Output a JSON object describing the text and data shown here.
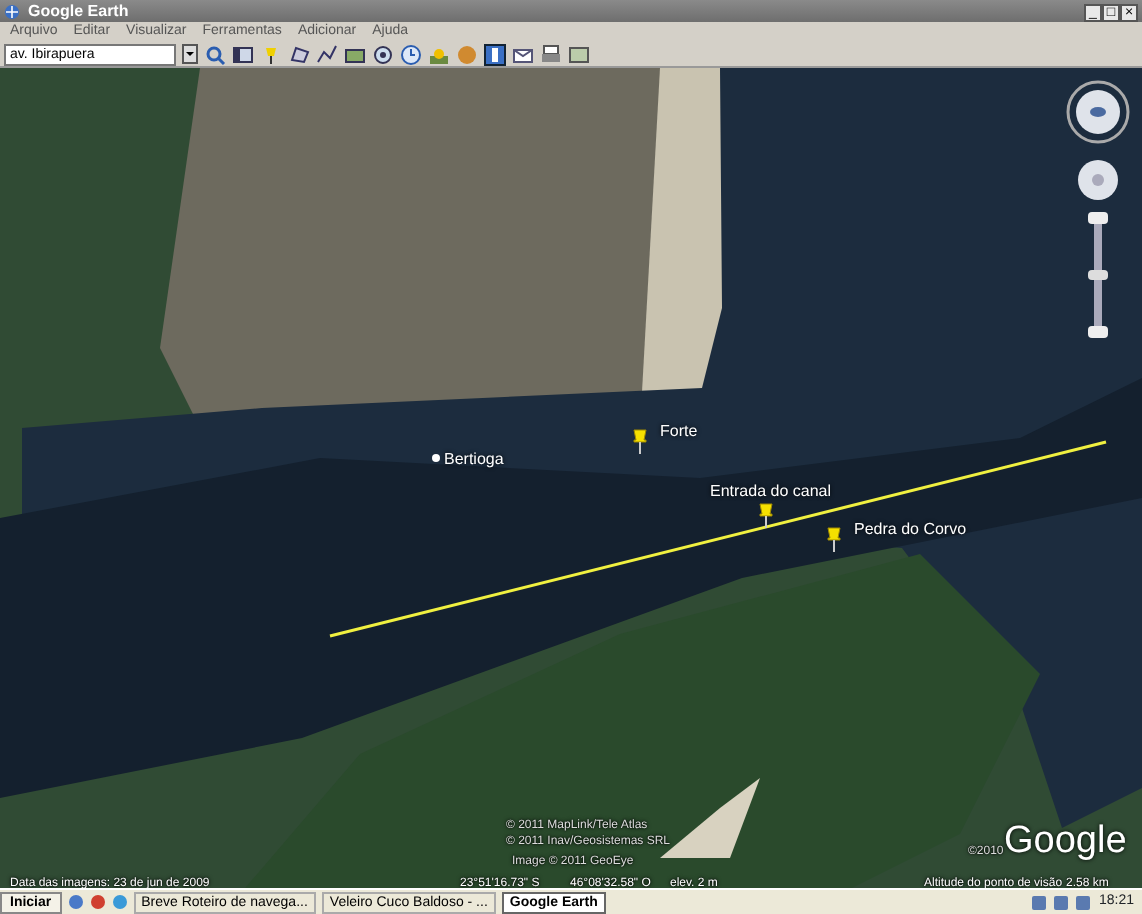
{
  "window": {
    "title": "Google Earth",
    "controls": [
      "_",
      "□",
      "×"
    ]
  },
  "menu": [
    "Arquivo",
    "Editar",
    "Visualizar",
    "Ferramentas",
    "Adicionar",
    "Ajuda"
  ],
  "search": {
    "value": "av. Ibirapuera"
  },
  "map": {
    "placemarks": [
      {
        "label": "Bertioga",
        "kind": "town"
      },
      {
        "label": "Forte",
        "kind": "pin"
      },
      {
        "label": "Entrada do canal",
        "kind": "pin"
      },
      {
        "label": "Pedra do Corvo",
        "kind": "pin"
      }
    ],
    "attributions": [
      "© 2011 MapLink/Tele Atlas",
      "© 2011 Inav/Geosistemas SRL",
      "Image © 2011 GeoEye"
    ],
    "logo_year": "©2010",
    "logo": "Google"
  },
  "status_bar": {
    "image_date": "Data das imagens: 23 de jun de 2009",
    "latitude": "23°51'16.73\" S",
    "longitude": "46°08'32.58\" O",
    "elevation": "elev. 2 m",
    "altitude_label": "Altitude do ponto de visão",
    "altitude": "2.58 km"
  },
  "taskbar": {
    "start": "Iniciar",
    "tasks": [
      {
        "label": "Breve Roteiro de navega...",
        "selected": false
      },
      {
        "label": "Veleiro Cuco Baldoso - ...",
        "selected": false
      },
      {
        "label": "Google Earth",
        "selected": true
      }
    ],
    "clock": "18:21"
  }
}
